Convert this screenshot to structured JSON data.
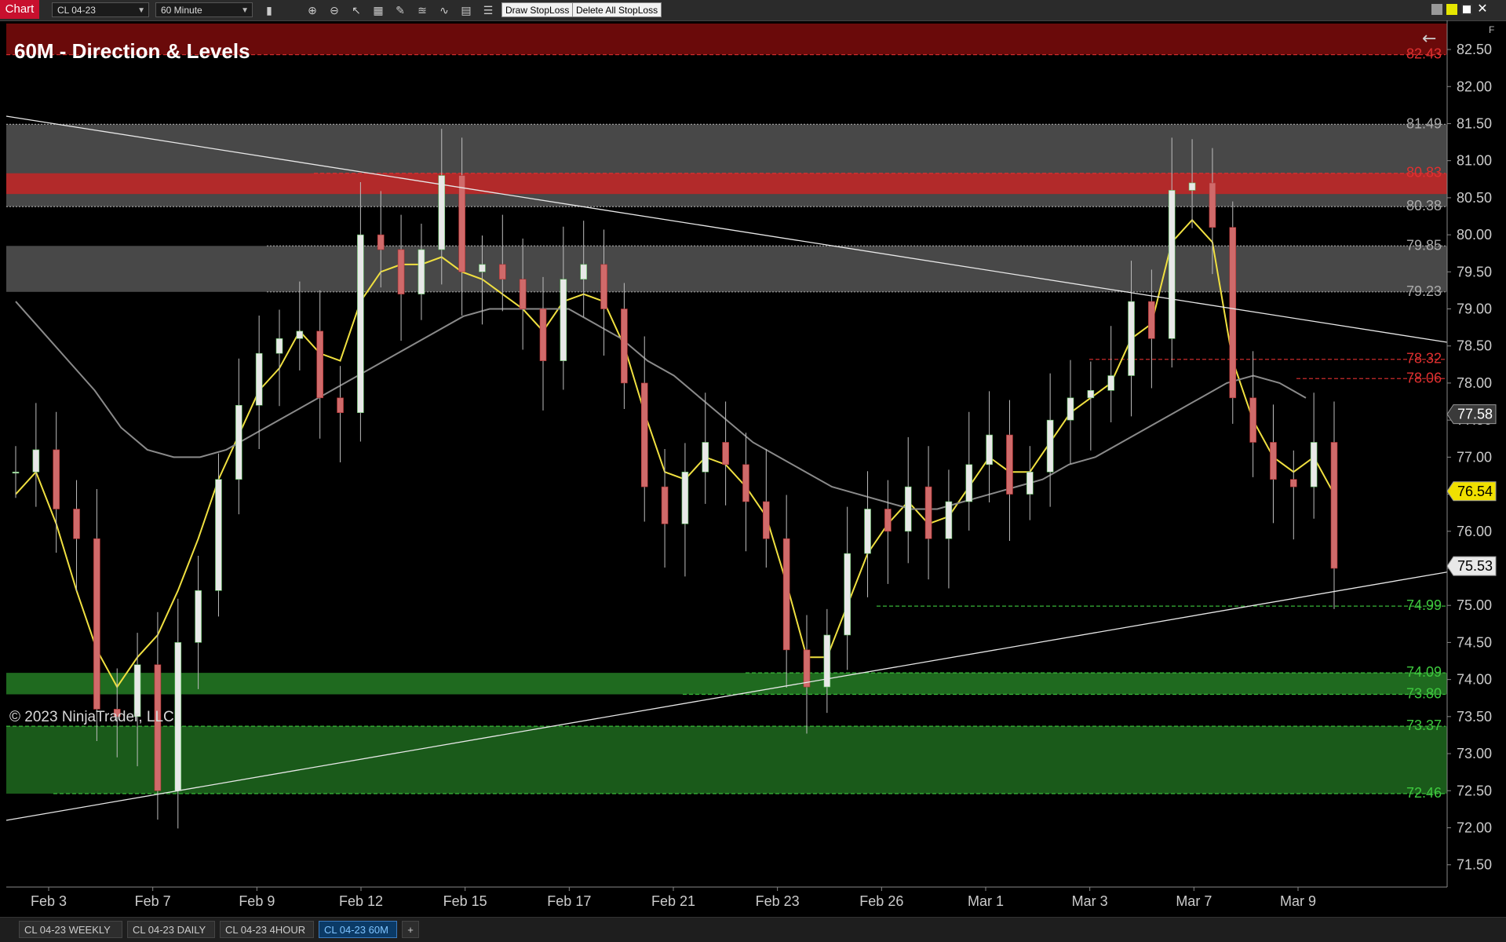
{
  "app": {
    "title": "Chart",
    "instrument": "CL 04-23",
    "interval": "60 Minute",
    "draw_stoploss_label": "Draw StopLoss",
    "delete_stoploss_label": "Delete All StopLoss",
    "f_label": "F"
  },
  "chart": {
    "title": "60M - Direction & Levels",
    "copyright": "© 2023 NinjaTrader, LLC",
    "back_arrow": "←"
  },
  "tabs": [
    {
      "label": "CL 04-23 WEEKLY",
      "active": false
    },
    {
      "label": "CL 04-23 DAILY",
      "active": false
    },
    {
      "label": "CL 04-23 4HOUR",
      "active": false
    },
    {
      "label": "CL 04-23 60M",
      "active": true
    }
  ],
  "add_tab_label": "+",
  "chart_data": {
    "type": "candlestick",
    "title": "60M - Direction & Levels",
    "y_ticks": [
      "82.50",
      "82.00",
      "81.50",
      "81.00",
      "80.50",
      "80.00",
      "79.50",
      "79.00",
      "78.50",
      "78.00",
      "77.50",
      "77.00",
      "76.50",
      "76.00",
      "75.50",
      "75.00",
      "74.50",
      "74.00",
      "73.50",
      "73.00",
      "72.50",
      "72.00",
      "71.50"
    ],
    "y_range": [
      71.2,
      82.85
    ],
    "x_labels": [
      "Feb 3",
      "Feb 7",
      "Feb 9",
      "Feb 12",
      "Feb 15",
      "Feb 17",
      "Feb 21",
      "Feb 23",
      "Feb 26",
      "Mar 1",
      "Mar 3",
      "Mar 7",
      "Mar 9"
    ],
    "level_labels": [
      {
        "value": "82.43",
        "color": "#e03030"
      },
      {
        "value": "81.49",
        "color": "#aaaaaa"
      },
      {
        "value": "80.83",
        "color": "#e03030"
      },
      {
        "value": "80.38",
        "color": "#aaaaaa"
      },
      {
        "value": "79.85",
        "color": "#aaaaaa"
      },
      {
        "value": "79.23",
        "color": "#aaaaaa"
      },
      {
        "value": "78.32",
        "color": "#e03030"
      },
      {
        "value": "78.06",
        "color": "#e03030"
      },
      {
        "value": "74.99",
        "color": "#3ec83e"
      },
      {
        "value": "74.09",
        "color": "#3ec83e"
      },
      {
        "value": "73.80",
        "color": "#3ec83e"
      },
      {
        "value": "73.37",
        "color": "#3ec83e"
      },
      {
        "value": "72.46",
        "color": "#3ec83e"
      }
    ],
    "zones": [
      {
        "from": 82.43,
        "to": 82.85,
        "color": "#6a0a0a"
      },
      {
        "from": 80.38,
        "to": 81.49,
        "color": "#484848"
      },
      {
        "from": 80.55,
        "to": 80.83,
        "color": "#b22a2a"
      },
      {
        "from": 79.23,
        "to": 79.85,
        "color": "#484848"
      },
      {
        "from": 73.8,
        "to": 74.09,
        "color": "#1f6a1f"
      },
      {
        "from": 72.46,
        "to": 73.37,
        "color": "#1a5a1a"
      }
    ],
    "price_tags": [
      {
        "value": "77.58",
        "style": "gray"
      },
      {
        "value": "76.54",
        "style": "yellow"
      },
      {
        "value": "75.53",
        "style": "light"
      }
    ],
    "series": [
      {
        "name": "",
        "close": [
          76.8,
          77.1,
          76.3,
          75.9,
          73.6,
          73.5,
          74.2,
          72.5,
          74.5,
          75.2,
          76.7,
          77.7,
          78.4,
          78.6,
          78.7,
          77.8,
          77.6,
          80.0,
          79.8,
          79.2,
          79.8,
          80.8,
          79.5,
          79.6,
          79.4,
          79.0,
          78.3,
          79.4,
          79.6,
          79.0,
          78.0,
          76.6,
          76.1,
          76.8,
          77.2,
          76.9,
          76.4,
          75.9,
          74.4,
          73.9,
          74.6,
          75.7,
          76.3,
          76.0,
          76.6,
          75.9,
          76.4,
          76.9,
          77.3,
          76.5,
          76.8,
          77.5,
          77.8,
          77.9,
          78.1,
          79.1,
          78.6,
          80.6,
          80.7,
          80.1,
          77.8,
          77.2,
          76.7,
          76.6,
          77.2,
          75.5
        ]
      },
      {
        "name": "",
        "values": [
          76.5,
          76.8,
          76.1,
          75.2,
          74.4,
          73.9,
          74.3,
          74.6,
          75.2,
          75.9,
          76.7,
          77.3,
          77.9,
          78.2,
          78.7,
          78.4,
          78.3,
          79.1,
          79.5,
          79.6,
          79.6,
          79.7,
          79.5,
          79.4,
          79.2,
          79.0,
          78.7,
          79.1,
          79.2,
          79.1,
          78.5,
          77.6,
          76.8,
          76.7,
          77.0,
          76.9,
          76.6,
          76.2,
          75.3,
          74.3,
          74.3,
          75.0,
          75.7,
          76.1,
          76.4,
          76.1,
          76.2,
          76.6,
          77.0,
          76.8,
          76.8,
          77.2,
          77.6,
          77.8,
          78.0,
          78.6,
          78.8,
          79.9,
          80.2,
          79.9,
          78.3,
          77.5,
          77.0,
          76.8,
          77.0,
          76.5
        ]
      },
      {
        "name": "",
        "values": [
          79.1,
          78.7,
          78.3,
          77.9,
          77.4,
          77.1,
          77.0,
          77.0,
          77.1,
          77.3,
          77.5,
          77.7,
          77.9,
          78.1,
          78.3,
          78.5,
          78.7,
          78.9,
          79.0,
          79.0,
          79.0,
          79.0,
          78.8,
          78.6,
          78.3,
          78.1,
          77.8,
          77.5,
          77.2,
          77.0,
          76.8,
          76.6,
          76.5,
          76.4,
          76.3,
          76.3,
          76.4,
          76.5,
          76.6,
          76.7,
          76.9,
          77.0,
          77.2,
          77.4,
          77.6,
          77.8,
          78.0,
          78.1,
          78.0,
          77.8
        ]
      }
    ],
    "trend_lines": [
      {
        "from": [
          0.0,
          81.6
        ],
        "to": [
          1.0,
          78.55
        ]
      },
      {
        "from": [
          0.0,
          72.1
        ],
        "to": [
          1.0,
          75.45
        ]
      }
    ]
  }
}
